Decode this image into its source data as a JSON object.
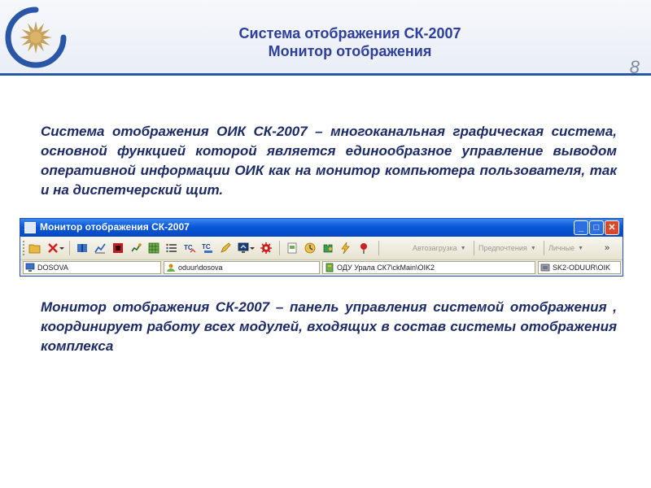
{
  "slide": {
    "title_line1": "Система отображения СК-2007",
    "title_line2": "Монитор отображения",
    "page_number": "8",
    "paragraph1": "Система отображения ОИК СК-2007 – многоканальная графическая система, основной функцией которой является единообразное управление выводом оперативной информации ОИК как на монитор компьютера пользователя, так и на диспетчерский щит.",
    "paragraph2": "Монитор отображения СК-2007 – панель управления системой отображения , координирует работу всех модулей, входящих в состав системы отображения комплекса"
  },
  "window": {
    "title": "Монитор отображения СК-2007",
    "min_label": "_",
    "max_label": "□",
    "close_label": "✕",
    "toolbar": {
      "icons": [
        "open-icon",
        "delete-icon",
        "book-icon",
        "chart-icon",
        "record-icon",
        "graph-icon",
        "grid-icon",
        "list-icon",
        "ts-icon",
        "tc-icon",
        "pen-icon",
        "monitor-icon",
        "gear-icon",
        "document-icon",
        "clock-icon",
        "puzzle-icon",
        "lightning-icon",
        "pin-icon"
      ],
      "tc_label_1": "TC",
      "tc_label_2": "TC",
      "dropdowns": [
        "Автозагрузка",
        "Предпочтения",
        "Личные"
      ],
      "dropdown_arrow": "▼",
      "overflow": "»"
    },
    "status": {
      "fields": [
        "DOSOVA",
        "oduur\\dosova",
        "ОДУ Урала СК7\\ckMain\\OIK2",
        "SK2-ODUUR\\OIK"
      ]
    }
  },
  "colors": {
    "title": "#2d3f9e",
    "text": "#1c2a68",
    "accent_line": "#2a56a8",
    "titlebar": "#0a57d8",
    "close": "#d8492a"
  }
}
